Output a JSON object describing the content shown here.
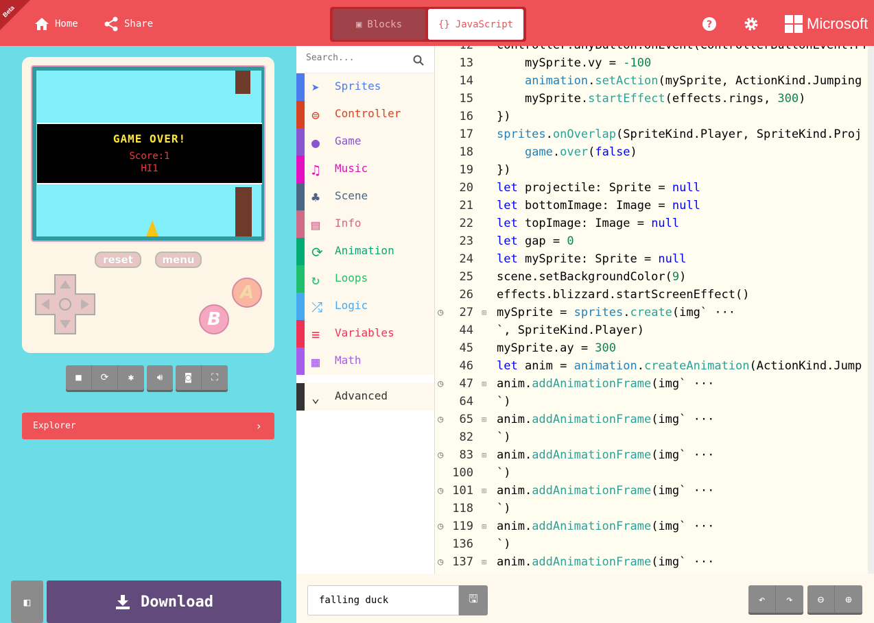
{
  "header": {
    "badge": "Beta",
    "home_label": "Home",
    "share_label": "Share",
    "tab_blocks": "Blocks",
    "tab_javascript": "JavaScript",
    "brand": "Microsoft"
  },
  "simulator": {
    "game_over": "GAME OVER!",
    "score": "Score:1",
    "hi": "HI1",
    "reset_label": "reset",
    "menu_label": "menu",
    "a_label": "A",
    "b_label": "B"
  },
  "explorer_label": "Explorer",
  "download_label": "Download",
  "toolbox": {
    "search_placeholder": "Search...",
    "categories": [
      {
        "label": "Sprites",
        "color": "#4b7bec"
      },
      {
        "label": "Controller",
        "color": "#d54322"
      },
      {
        "label": "Game",
        "color": "#8854d0"
      },
      {
        "label": "Music",
        "color": "#e30fc0"
      },
      {
        "label": "Scene",
        "color": "#4b6584"
      },
      {
        "label": "Info",
        "color": "#cf6a87"
      },
      {
        "label": "Animation",
        "color": "#03aa74"
      },
      {
        "label": "Loops",
        "color": "#20bf6b"
      },
      {
        "label": "Logic",
        "color": "#45aaf2"
      },
      {
        "label": "Variables",
        "color": "#ee3155"
      },
      {
        "label": "Math",
        "color": "#a55eea"
      },
      {
        "label": "Advanced",
        "color": "#333333"
      }
    ]
  },
  "code_lines": [
    {
      "n": "12",
      "t": "controller.anyButton.onEvent(ControllerButtonEvent.Pres"
    },
    {
      "n": "13",
      "t": "    mySprite.vy = -100"
    },
    {
      "n": "14",
      "t": "    animation.setAction(mySprite, ActionKind.Jumping"
    },
    {
      "n": "15",
      "t": "    mySprite.startEffect(effects.rings, 300)"
    },
    {
      "n": "16",
      "t": "})"
    },
    {
      "n": "17",
      "t": "sprites.onOverlap(SpriteKind.Player, SpriteKind.Proj"
    },
    {
      "n": "18",
      "t": "    game.over(false)"
    },
    {
      "n": "19",
      "t": "})"
    },
    {
      "n": "20",
      "t": "let projectile: Sprite = null"
    },
    {
      "n": "21",
      "t": "let bottomImage: Image = null"
    },
    {
      "n": "22",
      "t": "let topImage: Image = null"
    },
    {
      "n": "23",
      "t": "let gap = 0"
    },
    {
      "n": "24",
      "t": "let mySprite: Sprite = null"
    },
    {
      "n": "25",
      "t": "scene.setBackgroundColor(9)"
    },
    {
      "n": "26",
      "t": "effects.blizzard.startScreenEffect()"
    },
    {
      "n": "27",
      "t": "mySprite = sprites.create(img` ···",
      "fold": true
    },
    {
      "n": "44",
      "t": "`, SpriteKind.Player)"
    },
    {
      "n": "45",
      "t": "mySprite.ay = 300"
    },
    {
      "n": "46",
      "t": "let anim = animation.createAnimation(ActionKind.Jump"
    },
    {
      "n": "47",
      "t": "anim.addAnimationFrame(img` ···",
      "fold": true
    },
    {
      "n": "64",
      "t": "`)"
    },
    {
      "n": "65",
      "t": "anim.addAnimationFrame(img` ···",
      "fold": true
    },
    {
      "n": "82",
      "t": "`)"
    },
    {
      "n": "83",
      "t": "anim.addAnimationFrame(img` ···",
      "fold": true
    },
    {
      "n": "100",
      "t": "`)"
    },
    {
      "n": "101",
      "t": "anim.addAnimationFrame(img` ···",
      "fold": true
    },
    {
      "n": "118",
      "t": "`)"
    },
    {
      "n": "119",
      "t": "anim.addAnimationFrame(img` ···",
      "fold": true
    },
    {
      "n": "136",
      "t": "`)"
    },
    {
      "n": "137",
      "t": "anim.addAnimationFrame(img` ···",
      "fold": true
    }
  ],
  "project_name": "falling duck",
  "colors": {
    "accent": "#ee5257",
    "simulator_bg": "#6cdde6",
    "download": "#624b7c"
  }
}
